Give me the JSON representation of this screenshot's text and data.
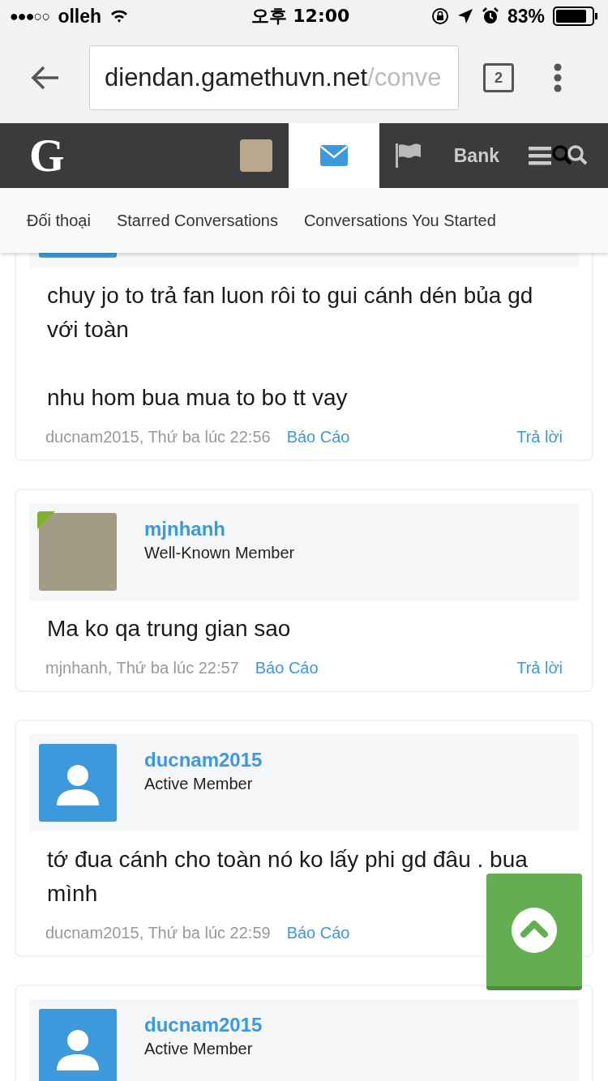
{
  "status_bar": {
    "signal": "●●●○○",
    "carrier": "olleh",
    "time": "오후 12:00",
    "battery": "83%"
  },
  "browser": {
    "url_host": "diendan.gamethuvn.net",
    "url_rest": "/conve",
    "tab_count": "2"
  },
  "site_nav": {
    "logo": "G",
    "items": [
      {
        "kind": "avatar",
        "selected": false
      },
      {
        "kind": "mail",
        "selected": true
      },
      {
        "kind": "flag",
        "selected": false
      },
      {
        "kind": "text",
        "label": "Bank",
        "selected": false
      },
      {
        "kind": "menu-search",
        "selected": false
      }
    ]
  },
  "sub_nav": [
    "Đối thoại",
    "Starred Conversations",
    "Conversations You Started"
  ],
  "posts": [
    {
      "kind": "cut",
      "online": false,
      "paragraphs": [
        "chuy jo to trả fan luon rôi to gui cánh dén bủa gd với toàn",
        "nhu hom bua mua to bo tt vay"
      ],
      "byline": "ducnam2015, Thứ ba lúc 22:56",
      "report": "Báo Cáo",
      "reply": "Trả lời"
    },
    {
      "kind": "photo",
      "online": true,
      "author": "mjnhanh",
      "role": "Well-Known Member",
      "paragraphs": [
        "Ma ko qa trung gian sao"
      ],
      "byline": "mjnhanh, Thứ ba lúc 22:57",
      "report": "Báo Cáo",
      "reply": "Trả lời"
    },
    {
      "kind": "default",
      "online": false,
      "author": "ducnam2015",
      "role": "Active Member",
      "paragraphs": [
        "tớ đua cánh cho toàn nó ko lấy phi gd đâu . bua mình"
      ],
      "byline": "ducnam2015, Thứ ba lúc 22:59",
      "report": "Báo Cáo"
    },
    {
      "kind": "default",
      "online": false,
      "author": "ducnam2015",
      "role": "Active Member"
    }
  ]
}
